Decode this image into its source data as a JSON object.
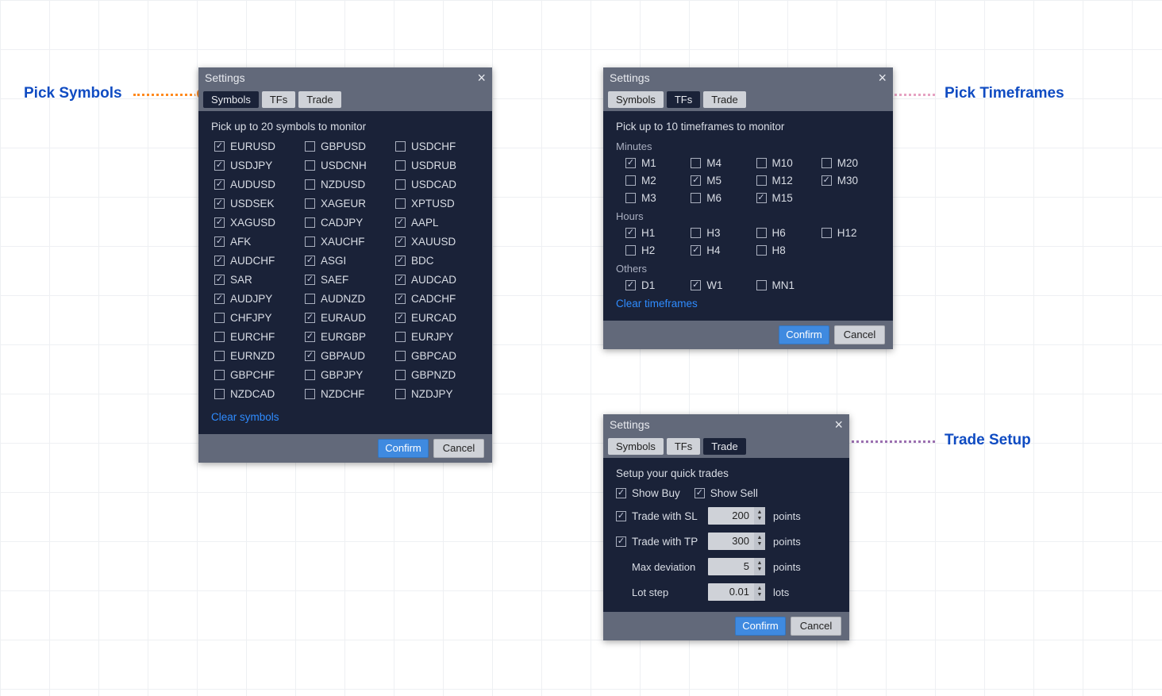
{
  "annotations": {
    "pick_symbols": "Pick Symbols",
    "pick_timeframes": "Pick Timeframes",
    "trade_setup": "Trade Setup"
  },
  "dialog_common": {
    "title": "Settings",
    "confirm": "Confirm",
    "cancel": "Cancel",
    "tabs": {
      "symbols": "Symbols",
      "tfs": "TFs",
      "trade": "Trade"
    }
  },
  "symbols_dialog": {
    "instruction": "Pick up to 20 symbols to monitor",
    "clear": "Clear symbols",
    "items": [
      {
        "l": "EURUSD",
        "c": true
      },
      {
        "l": "GBPUSD",
        "c": false
      },
      {
        "l": "USDCHF",
        "c": false
      },
      {
        "l": "USDJPY",
        "c": true
      },
      {
        "l": "USDCNH",
        "c": false
      },
      {
        "l": "USDRUB",
        "c": false
      },
      {
        "l": "AUDUSD",
        "c": true
      },
      {
        "l": "NZDUSD",
        "c": false
      },
      {
        "l": "USDCAD",
        "c": false
      },
      {
        "l": "USDSEK",
        "c": true
      },
      {
        "l": "XAGEUR",
        "c": false
      },
      {
        "l": "XPTUSD",
        "c": false
      },
      {
        "l": "XAGUSD",
        "c": true
      },
      {
        "l": "CADJPY",
        "c": false
      },
      {
        "l": "AAPL",
        "c": true
      },
      {
        "l": "AFK",
        "c": true
      },
      {
        "l": "XAUCHF",
        "c": false
      },
      {
        "l": "XAUUSD",
        "c": true
      },
      {
        "l": "AUDCHF",
        "c": true
      },
      {
        "l": "ASGI",
        "c": true
      },
      {
        "l": "BDC",
        "c": true
      },
      {
        "l": "SAR",
        "c": true
      },
      {
        "l": "SAEF",
        "c": true
      },
      {
        "l": "AUDCAD",
        "c": true
      },
      {
        "l": "AUDJPY",
        "c": true
      },
      {
        "l": "AUDNZD",
        "c": false
      },
      {
        "l": "CADCHF",
        "c": true
      },
      {
        "l": "CHFJPY",
        "c": false
      },
      {
        "l": "EURAUD",
        "c": true
      },
      {
        "l": "EURCAD",
        "c": true
      },
      {
        "l": "EURCHF",
        "c": false
      },
      {
        "l": "EURGBP",
        "c": true
      },
      {
        "l": "EURJPY",
        "c": false
      },
      {
        "l": "EURNZD",
        "c": false
      },
      {
        "l": "GBPAUD",
        "c": true
      },
      {
        "l": "GBPCAD",
        "c": false
      },
      {
        "l": "GBPCHF",
        "c": false
      },
      {
        "l": "GBPJPY",
        "c": false
      },
      {
        "l": "GBPNZD",
        "c": false
      },
      {
        "l": "NZDCAD",
        "c": false
      },
      {
        "l": "NZDCHF",
        "c": false
      },
      {
        "l": "NZDJPY",
        "c": false
      }
    ]
  },
  "tfs_dialog": {
    "instruction": "Pick up to 10 timeframes to monitor",
    "clear": "Clear timeframes",
    "sections": {
      "minutes": {
        "label": "Minutes",
        "items": [
          {
            "l": "M1",
            "c": true
          },
          {
            "l": "M4",
            "c": false
          },
          {
            "l": "M10",
            "c": false
          },
          {
            "l": "M20",
            "c": false
          },
          {
            "l": "M2",
            "c": false
          },
          {
            "l": "M5",
            "c": true
          },
          {
            "l": "M12",
            "c": false
          },
          {
            "l": "M30",
            "c": true
          },
          {
            "l": "M3",
            "c": false
          },
          {
            "l": "M6",
            "c": false
          },
          {
            "l": "M15",
            "c": true
          }
        ]
      },
      "hours": {
        "label": "Hours",
        "items": [
          {
            "l": "H1",
            "c": true
          },
          {
            "l": "H3",
            "c": false
          },
          {
            "l": "H6",
            "c": false
          },
          {
            "l": "H12",
            "c": false
          },
          {
            "l": "H2",
            "c": false
          },
          {
            "l": "H4",
            "c": true
          },
          {
            "l": "H8",
            "c": false
          }
        ]
      },
      "others": {
        "label": "Others",
        "items": [
          {
            "l": "D1",
            "c": true
          },
          {
            "l": "W1",
            "c": true
          },
          {
            "l": "MN1",
            "c": false
          }
        ]
      }
    }
  },
  "trade_dialog": {
    "instruction": "Setup your quick trades",
    "show_buy": {
      "label": "Show Buy",
      "checked": true
    },
    "show_sell": {
      "label": "Show Sell",
      "checked": true
    },
    "sl": {
      "label": "Trade with SL",
      "checked": true,
      "value": "200",
      "unit": "points"
    },
    "tp": {
      "label": "Trade with TP",
      "checked": true,
      "value": "300",
      "unit": "points"
    },
    "dev": {
      "label": "Max deviation",
      "value": "5",
      "unit": "points"
    },
    "lot": {
      "label": "Lot step",
      "value": "0.01",
      "unit": "lots"
    }
  }
}
